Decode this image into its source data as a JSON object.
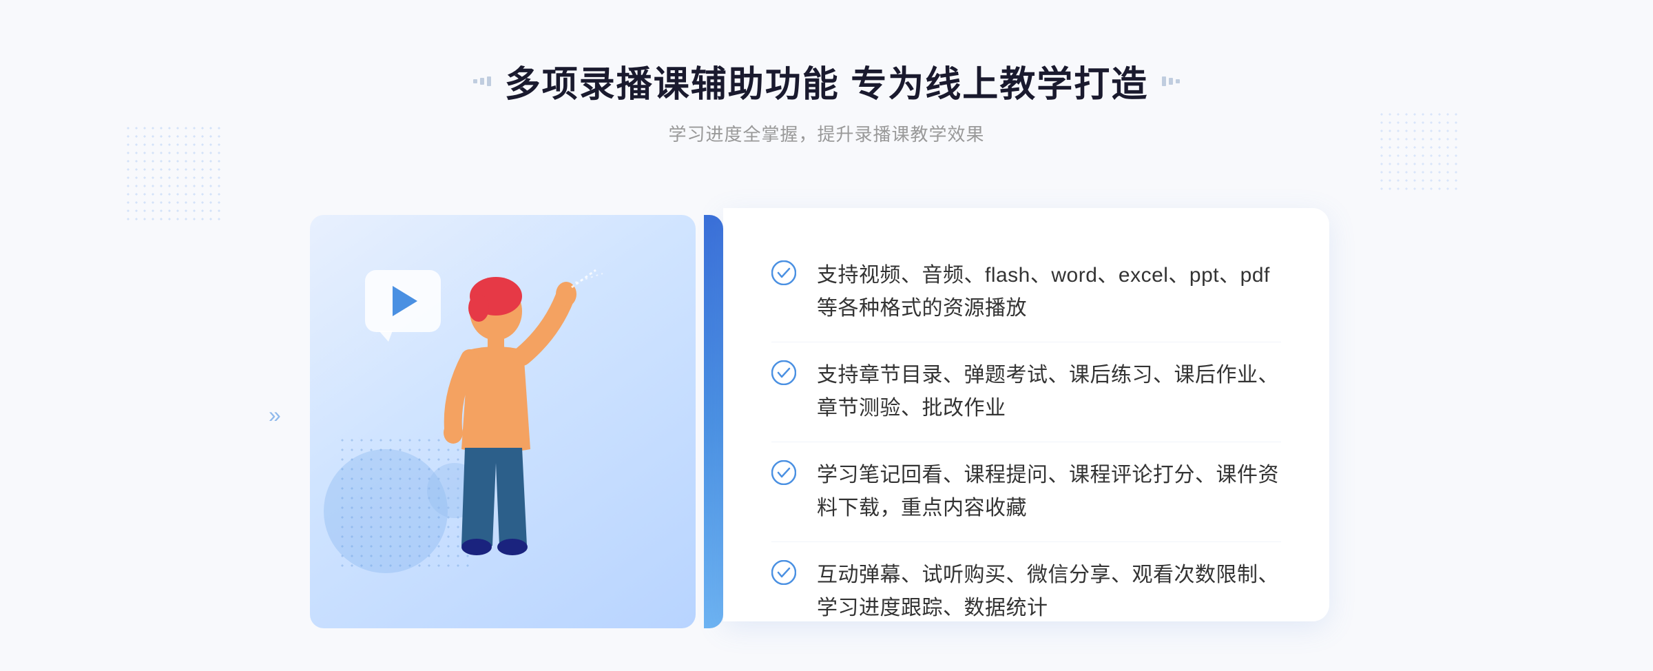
{
  "header": {
    "title": "多项录播课辅助功能 专为线上教学打造",
    "subtitle": "学习进度全掌握，提升录播课教学效果",
    "left_decorator_label": "left-dots",
    "right_decorator_label": "right-dots"
  },
  "features": [
    {
      "id": 1,
      "text": "支持视频、音频、flash、word、excel、ppt、pdf等各种格式的资源播放"
    },
    {
      "id": 2,
      "text": "支持章节目录、弹题考试、课后练习、课后作业、章节测验、批改作业"
    },
    {
      "id": 3,
      "text": "学习笔记回看、课程提问、课程评论打分、课件资料下载，重点内容收藏"
    },
    {
      "id": 4,
      "text": "互动弹幕、试听购买、微信分享、观看次数限制、学习进度跟踪、数据统计"
    }
  ],
  "colors": {
    "primary": "#4a90e2",
    "accent": "#3a6fd8",
    "text_dark": "#1a1a2e",
    "text_gray": "#999999",
    "text_body": "#333333",
    "bg_page": "#f8f9fc",
    "bg_card": "#ffffff",
    "bg_illustration": "#d0e4ff",
    "check_color": "#4a90e2",
    "border_color": "#f0f4fa"
  },
  "icons": {
    "check": "check-circle-icon",
    "play": "play-icon",
    "left_arrow": "»",
    "right_arrow": "«"
  }
}
